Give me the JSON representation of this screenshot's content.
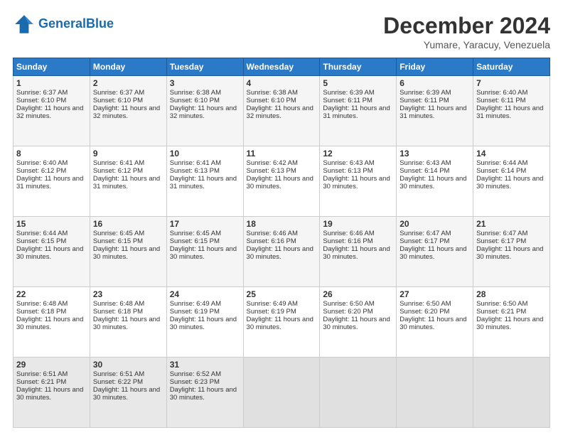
{
  "header": {
    "logo_general": "General",
    "logo_blue": "Blue",
    "month": "December 2024",
    "location": "Yumare, Yaracuy, Venezuela"
  },
  "weekdays": [
    "Sunday",
    "Monday",
    "Tuesday",
    "Wednesday",
    "Thursday",
    "Friday",
    "Saturday"
  ],
  "weeks": [
    [
      {
        "day": "1",
        "sunrise": "6:37 AM",
        "sunset": "6:10 PM",
        "daylight": "11 hours and 32 minutes."
      },
      {
        "day": "2",
        "sunrise": "6:37 AM",
        "sunset": "6:10 PM",
        "daylight": "11 hours and 32 minutes."
      },
      {
        "day": "3",
        "sunrise": "6:38 AM",
        "sunset": "6:10 PM",
        "daylight": "11 hours and 32 minutes."
      },
      {
        "day": "4",
        "sunrise": "6:38 AM",
        "sunset": "6:10 PM",
        "daylight": "11 hours and 32 minutes."
      },
      {
        "day": "5",
        "sunrise": "6:39 AM",
        "sunset": "6:11 PM",
        "daylight": "11 hours and 31 minutes."
      },
      {
        "day": "6",
        "sunrise": "6:39 AM",
        "sunset": "6:11 PM",
        "daylight": "11 hours and 31 minutes."
      },
      {
        "day": "7",
        "sunrise": "6:40 AM",
        "sunset": "6:11 PM",
        "daylight": "11 hours and 31 minutes."
      }
    ],
    [
      {
        "day": "8",
        "sunrise": "6:40 AM",
        "sunset": "6:12 PM",
        "daylight": "11 hours and 31 minutes."
      },
      {
        "day": "9",
        "sunrise": "6:41 AM",
        "sunset": "6:12 PM",
        "daylight": "11 hours and 31 minutes."
      },
      {
        "day": "10",
        "sunrise": "6:41 AM",
        "sunset": "6:13 PM",
        "daylight": "11 hours and 31 minutes."
      },
      {
        "day": "11",
        "sunrise": "6:42 AM",
        "sunset": "6:13 PM",
        "daylight": "11 hours and 30 minutes."
      },
      {
        "day": "12",
        "sunrise": "6:43 AM",
        "sunset": "6:13 PM",
        "daylight": "11 hours and 30 minutes."
      },
      {
        "day": "13",
        "sunrise": "6:43 AM",
        "sunset": "6:14 PM",
        "daylight": "11 hours and 30 minutes."
      },
      {
        "day": "14",
        "sunrise": "6:44 AM",
        "sunset": "6:14 PM",
        "daylight": "11 hours and 30 minutes."
      }
    ],
    [
      {
        "day": "15",
        "sunrise": "6:44 AM",
        "sunset": "6:15 PM",
        "daylight": "11 hours and 30 minutes."
      },
      {
        "day": "16",
        "sunrise": "6:45 AM",
        "sunset": "6:15 PM",
        "daylight": "11 hours and 30 minutes."
      },
      {
        "day": "17",
        "sunrise": "6:45 AM",
        "sunset": "6:15 PM",
        "daylight": "11 hours and 30 minutes."
      },
      {
        "day": "18",
        "sunrise": "6:46 AM",
        "sunset": "6:16 PM",
        "daylight": "11 hours and 30 minutes."
      },
      {
        "day": "19",
        "sunrise": "6:46 AM",
        "sunset": "6:16 PM",
        "daylight": "11 hours and 30 minutes."
      },
      {
        "day": "20",
        "sunrise": "6:47 AM",
        "sunset": "6:17 PM",
        "daylight": "11 hours and 30 minutes."
      },
      {
        "day": "21",
        "sunrise": "6:47 AM",
        "sunset": "6:17 PM",
        "daylight": "11 hours and 30 minutes."
      }
    ],
    [
      {
        "day": "22",
        "sunrise": "6:48 AM",
        "sunset": "6:18 PM",
        "daylight": "11 hours and 30 minutes."
      },
      {
        "day": "23",
        "sunrise": "6:48 AM",
        "sunset": "6:18 PM",
        "daylight": "11 hours and 30 minutes."
      },
      {
        "day": "24",
        "sunrise": "6:49 AM",
        "sunset": "6:19 PM",
        "daylight": "11 hours and 30 minutes."
      },
      {
        "day": "25",
        "sunrise": "6:49 AM",
        "sunset": "6:19 PM",
        "daylight": "11 hours and 30 minutes."
      },
      {
        "day": "26",
        "sunrise": "6:50 AM",
        "sunset": "6:20 PM",
        "daylight": "11 hours and 30 minutes."
      },
      {
        "day": "27",
        "sunrise": "6:50 AM",
        "sunset": "6:20 PM",
        "daylight": "11 hours and 30 minutes."
      },
      {
        "day": "28",
        "sunrise": "6:50 AM",
        "sunset": "6:21 PM",
        "daylight": "11 hours and 30 minutes."
      }
    ],
    [
      {
        "day": "29",
        "sunrise": "6:51 AM",
        "sunset": "6:21 PM",
        "daylight": "11 hours and 30 minutes."
      },
      {
        "day": "30",
        "sunrise": "6:51 AM",
        "sunset": "6:22 PM",
        "daylight": "11 hours and 30 minutes."
      },
      {
        "day": "31",
        "sunrise": "6:52 AM",
        "sunset": "6:23 PM",
        "daylight": "11 hours and 30 minutes."
      },
      null,
      null,
      null,
      null
    ]
  ]
}
